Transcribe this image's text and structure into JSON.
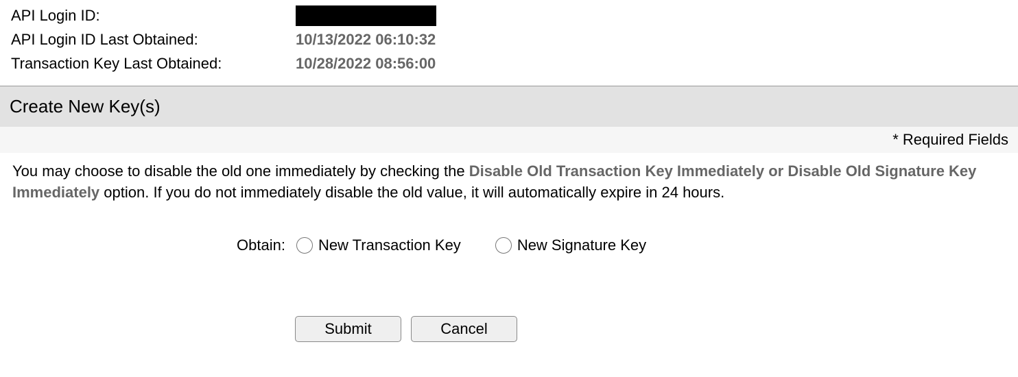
{
  "info": {
    "api_login_id_label": "API Login ID:",
    "api_login_id_last_obtained_label": "API Login ID Last Obtained:",
    "api_login_id_last_obtained_value": "10/13/2022 06:10:32",
    "transaction_key_last_obtained_label": "Transaction Key Last Obtained:",
    "transaction_key_last_obtained_value": "10/28/2022 08:56:00"
  },
  "section": {
    "title": "Create New Key(s)",
    "required_fields": "* Required Fields"
  },
  "desc": {
    "part1": "You may choose to disable the old one immediately by checking the ",
    "bold": "Disable Old Transaction Key Immediately or Disable Old Signature Key Immediately",
    "part2": " option. If you do not immediately disable the old value, it will automatically expire in 24 hours."
  },
  "obtain": {
    "label": "Obtain:",
    "option1": "New Transaction Key",
    "option2": "New Signature Key"
  },
  "buttons": {
    "submit": "Submit",
    "cancel": "Cancel"
  }
}
